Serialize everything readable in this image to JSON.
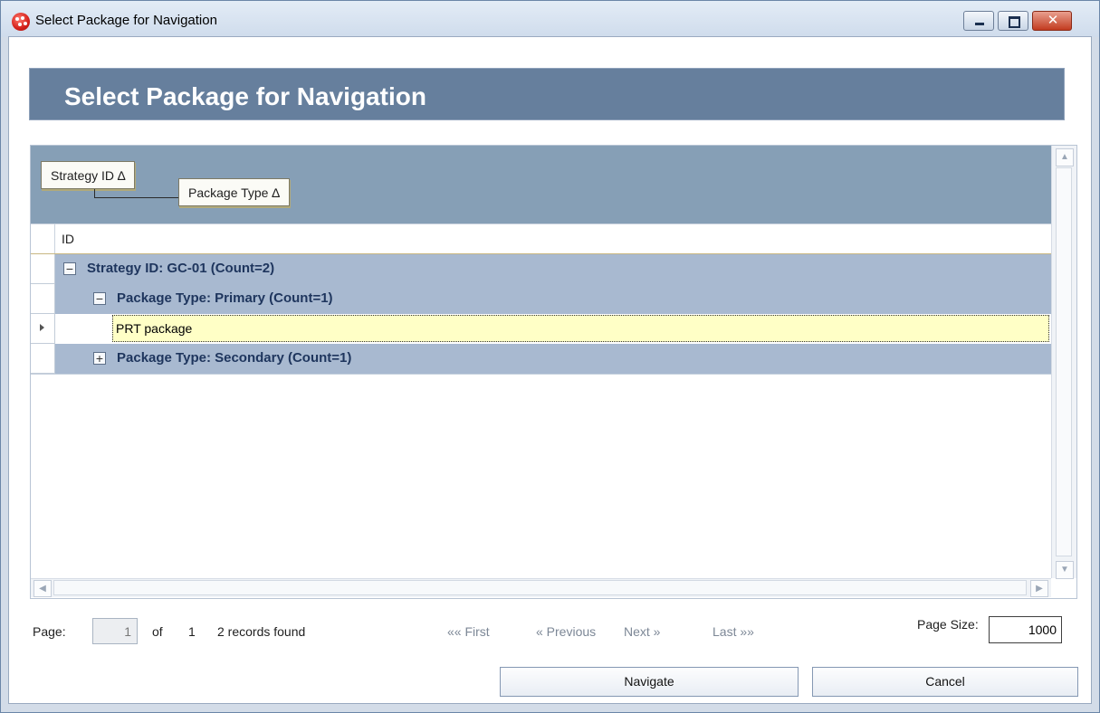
{
  "window": {
    "title": "Select Package for Navigation"
  },
  "header": {
    "title": "Select Package for Navigation"
  },
  "group_by": [
    {
      "label": "Strategy ID ∆"
    },
    {
      "label": "Package Type ∆"
    }
  ],
  "grid": {
    "column_header": "ID",
    "groups": [
      {
        "label": "Strategy ID: GC-01 (Count=2)",
        "toggle": "−"
      },
      {
        "label": "Package Type: Primary (Count=1)",
        "toggle": "−"
      },
      {
        "label": "Package Type: Secondary (Count=1)",
        "toggle": "+"
      }
    ],
    "data_row": {
      "value": "PRT package"
    },
    "scroll": {
      "up": "▲",
      "down": "▼",
      "left": "◀",
      "right": "▶"
    }
  },
  "pager": {
    "page_label": "Page:",
    "page_value": "1",
    "of_label": "of",
    "total_pages": "1",
    "records_found": "2 records found",
    "first": "«« First",
    "previous": "« Previous",
    "next": "Next »",
    "last": "Last »»",
    "page_size_label": "Page Size:",
    "page_size_value": "1000"
  },
  "buttons": {
    "navigate": "Navigate",
    "cancel": "Cancel"
  },
  "colors": {
    "header_band": "#667f9d",
    "group_row": "#a8b9d0",
    "selected_row": "#ffffc6"
  }
}
